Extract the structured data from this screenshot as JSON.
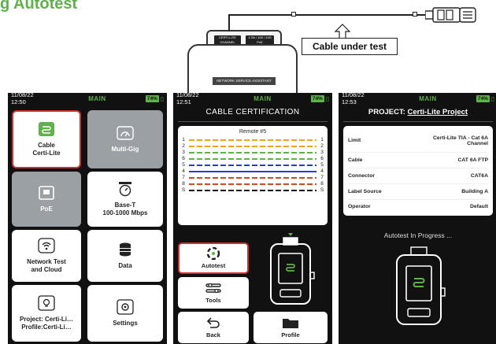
{
  "header": {
    "title": "g Autotest"
  },
  "device": {
    "port_left": "CERTI-LITE CHANNEL",
    "port_right": "1 Gb / 100 / 10G PoE",
    "label": "NETWORK SERVICE ASSISTANT"
  },
  "callout": {
    "label": "Cable under test"
  },
  "panels": [
    {
      "status": {
        "time": "11/08/22 12:50",
        "mode": "MAIN",
        "battery": "74%"
      },
      "tiles": [
        {
          "label": "Cable\nCerti-Lite",
          "icon": "cable-icon"
        },
        {
          "label": "Multi-Gig",
          "icon": "gauge-icon"
        },
        {
          "label": "PoE",
          "icon": "poe-icon"
        },
        {
          "label": "Base-T\n100-1000 Mbps",
          "icon": "stopwatch-icon"
        },
        {
          "label": "Network Test\nand Cloud",
          "icon": "network-cloud-icon"
        },
        {
          "label": "Data",
          "icon": "database-icon"
        },
        {
          "label": "Project: Certi-Li…\nProfile:Certi-Li…",
          "icon": "lightbulb-icon"
        },
        {
          "label": "Settings",
          "icon": "settings-icon"
        }
      ]
    },
    {
      "status": {
        "time": "11/08/22 12:51",
        "mode": "MAIN",
        "battery": "74%"
      },
      "title": "CABLE CERTIFICATION",
      "remote": "Remote #5",
      "left_pins": [
        "1",
        "2",
        "3",
        "6",
        "5",
        "4",
        "7",
        "8",
        "S"
      ],
      "right_pins": [
        "1",
        "2",
        "3",
        "6",
        "5",
        "4",
        "7",
        "8",
        "S"
      ],
      "wire_colors": [
        "#f7a21b",
        "#f7a21b",
        "#5fb14a",
        "#5fb14a",
        "#1f3fd6",
        "#1f3fd6",
        "#c8501e",
        "#c8501e",
        "#111111"
      ],
      "buttons": {
        "autotest": "Autotest",
        "tools": "Tools",
        "back": "Back",
        "profile": "Profile"
      }
    },
    {
      "status": {
        "time": "11/08/22 12:53",
        "mode": "MAIN",
        "battery": "74%"
      },
      "title_prefix": "PROJECT: ",
      "title_name": "Certi-Lite Project",
      "rows": [
        {
          "k": "Limit",
          "v": "Certi-Lite TIA - Cat 6A\nChannel"
        },
        {
          "k": "Cable",
          "v": "CAT 6A FTP"
        },
        {
          "k": "Connector",
          "v": "CAT6A"
        },
        {
          "k": "Label Source",
          "v": "Building A"
        },
        {
          "k": "Operator",
          "v": "Default"
        }
      ],
      "progress": "Autotest In Progress ..."
    }
  ]
}
